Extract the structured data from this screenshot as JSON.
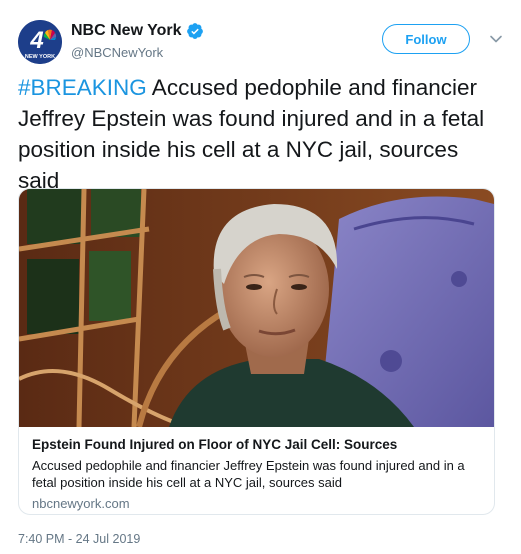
{
  "account": {
    "display_name": "NBC New York",
    "handle": "@NBCNewYork",
    "verified": true,
    "avatar_icon": "nbc-4-peacock-logo",
    "avatar_logo_number": "4",
    "avatar_logo_text": "NEW YORK"
  },
  "follow_button": {
    "label": "Follow",
    "color": "#1da1f2"
  },
  "tweet": {
    "hashtag": "#BREAKING",
    "text": " Accused pedophile and financier Jeffrey Epstein was found injured and in a fetal position inside his cell at a NYC jail, sources said"
  },
  "card": {
    "image_icon": "photo-man-portrait",
    "title": "Epstein Found Injured on Floor of NYC Jail Cell: Sources",
    "description": "Accused pedophile and financier Jeffrey Epstein was found injured and in a fetal position inside his cell at a NYC jail, sources said",
    "domain": "nbcnewyork.com"
  },
  "timestamp": "7:40 PM - 24 Jul 2019",
  "colors": {
    "link": "#1b95e0",
    "muted": "#657786",
    "text": "#14171a"
  }
}
